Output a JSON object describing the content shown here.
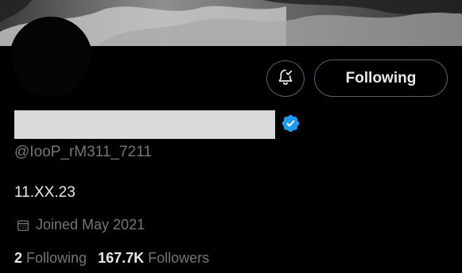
{
  "profile": {
    "handle": "@IooP_rM311_7211",
    "bio": "11.XX.23",
    "joined": "Joined May 2021",
    "verified": true
  },
  "actions": {
    "following_label": "Following",
    "bell_icon": "bell-check-icon"
  },
  "stats": {
    "following_count": "2",
    "following_label": "Following",
    "followers_count": "167.7K",
    "followers_label": "Followers"
  },
  "icons": {
    "calendar": "calendar-icon",
    "verified": "verified-badge-icon"
  },
  "colors": {
    "background": "#000000",
    "primary_text": "#e7e9ea",
    "secondary_text": "#71767b",
    "verified_blue": "#1d9bf0",
    "name_redaction": "#d9d9d9"
  }
}
